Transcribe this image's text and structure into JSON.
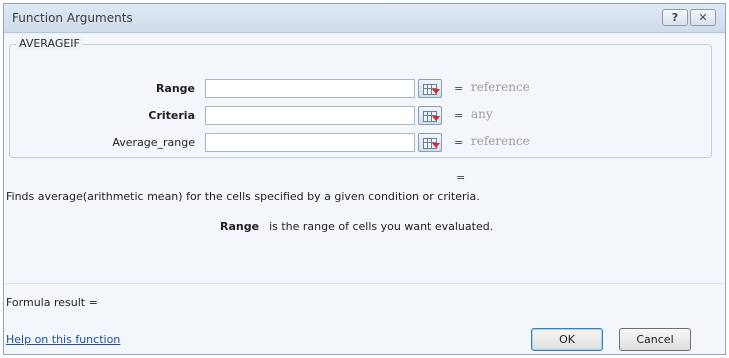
{
  "window": {
    "title": "Function Arguments",
    "help_glyph": "?",
    "close_glyph": "✕"
  },
  "function_group": {
    "name": "AVERAGEIF",
    "arguments": [
      {
        "label": "Range",
        "value": "",
        "result": "reference",
        "bold": true
      },
      {
        "label": "Criteria",
        "value": "",
        "result": "any",
        "bold": true
      },
      {
        "label": "Average_range",
        "value": "",
        "result": "reference",
        "bold": false
      }
    ],
    "equals": "="
  },
  "function_result_equals": "=",
  "description": "Finds average(arithmetic mean) for the cells specified by a given condition or criteria.",
  "argument_help": {
    "name": "Range",
    "text": "is the range of cells you want evaluated."
  },
  "formula_result_label": "Formula result =",
  "help_link": "Help on this function",
  "buttons": {
    "ok": "OK",
    "cancel": "Cancel"
  },
  "icons": {
    "collapse": "range-selector-icon"
  }
}
